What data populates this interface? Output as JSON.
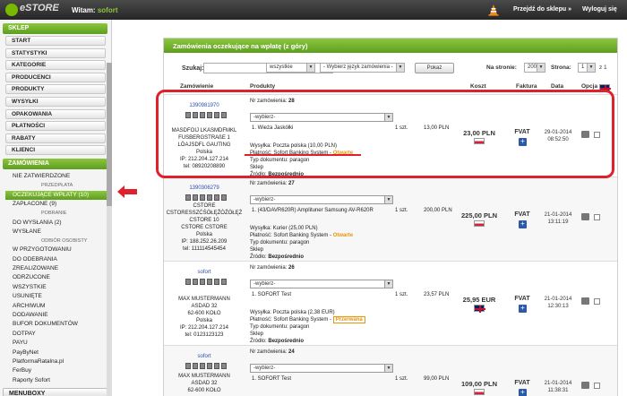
{
  "topbar": {
    "logo": "eSTORE",
    "welcome": "Witam:",
    "user": "sofort",
    "goto_store": "Przejdź do sklepu »",
    "logout": "Wyloguj się"
  },
  "sidebar": {
    "section1": "SKLEP",
    "items": [
      "START",
      "STATYSTYKI",
      "KATEGORIE",
      "PRODUCENCI",
      "PRODUKTY",
      "WYSYŁKI",
      "OPAKOWANIA",
      "PŁATNOŚCI",
      "RABATY",
      "KLIENCI"
    ],
    "section2": "ZAMÓWIENIA",
    "orders": [
      {
        "label": "NIE ZATWIERDZONE",
        "kind": "item"
      },
      {
        "label": "PRZEDPŁATA",
        "kind": "group"
      },
      {
        "label": "OCZEKUJĄCE WPŁATY (10)",
        "kind": "active"
      },
      {
        "label": "ZAPŁACONE (9)",
        "kind": "item"
      },
      {
        "label": "POBRANIE",
        "kind": "group"
      },
      {
        "label": "DO WYSŁANIA (2)",
        "kind": "item"
      },
      {
        "label": "WYSŁANE",
        "kind": "item"
      },
      {
        "label": "ODBIÓR OSOBISTY",
        "kind": "group"
      },
      {
        "label": "W PRZYGOTOWANIU",
        "kind": "item"
      },
      {
        "label": "DO ODEBRANIA",
        "kind": "item"
      }
    ],
    "orders2": [
      "ZREALIZOWANE",
      "ODRZUCONE",
      "WSZYSTKIE",
      "USUNIĘTE",
      "ARCHIWUM",
      "DODAWANIE",
      "BUFOR DOKUMENTÓW",
      "DOTPAY",
      "PAYU",
      "PayByNet",
      "PlatformaRatalna.pl",
      "FerBuy",
      "Raporty Sofort"
    ],
    "section3": "MENUBOXY"
  },
  "panel": {
    "title": "Zamówienia oczekujące na wpłatę (z góry)",
    "search_label": "Szukaj:",
    "filter_value": "wszystkie",
    "language_value": "- Wybierz język zamówienia -",
    "search_button": "Pokaż",
    "per_page_label": "Na stronie:",
    "per_page_value": "200",
    "page_label": "Strona:",
    "page_value": "1",
    "page_total": "z 1",
    "columns": {
      "order": "Zamówienie",
      "products": "Produkty",
      "cost": "Koszt",
      "invoice": "Faktura",
      "date": "Data",
      "option": "Opcja"
    }
  },
  "orders": [
    {
      "id_link": "1390981970",
      "customer": [
        "MASDFOIJ LKASMDFMKL",
        "FUSBERGSTRAßE 1",
        "LÖAJSDFL GAUTING",
        "Polska"
      ],
      "ip": "IP: 212.204.127.214",
      "tel": "tel: 08920208890",
      "order_no_label": "Nr zamówienia:",
      "order_no": "28",
      "select": "-wybierz-",
      "product": "1. Wieża Jaskółki",
      "qty": "1 szt.",
      "line_price": "13,00 PLN",
      "shipping": "Wysyłka: Poczta polska (10,00 PLN)",
      "payment": "Płatność: Sofort Banking System - ",
      "status": "Otwarte",
      "doc": "Typ dokumentu: paragon",
      "shop": "Sklep",
      "source_label": "Źródło:",
      "source": "Bezpośrednio",
      "price": "23,00 PLN",
      "invoice": "FVAT",
      "date": "29-01-2014",
      "time": "08:52:50"
    },
    {
      "id_link": "1390306279",
      "customer": [
        "CSTORE",
        "CSTORESSZĆŚÓŁĘŹÓŹÓŁĘŻ",
        "CSTORE 10",
        "CSTORE CSTORE",
        "Polska"
      ],
      "ip": "IP: 188.252.26.209",
      "tel": "tel: 111114545454",
      "order_no_label": "Nr zamówienia:",
      "order_no": "27",
      "select": "-wybierz-",
      "product": "1. (43/DAVR620R) Amplituner Samsung AV-R620R",
      "qty": "1 szt.",
      "line_price": "200,00 PLN",
      "shipping": "Wysyłka: Kurier (25,00 PLN)",
      "payment": "Płatność: Sofort Banking System - ",
      "status": "Otwarte",
      "doc": "Typ dokumentu: paragon",
      "shop": "Sklep",
      "source_label": "Źródło:",
      "source": "Bezpośrednio",
      "price": "225,00 PLN",
      "invoice": "FVAT",
      "date": "21-01-2014",
      "time": "13:11:19"
    },
    {
      "id_link": "sofort",
      "customer": [
        "MAX MUSTERMANN",
        "ASDAD 32",
        "62-600 KOŁO",
        "Polska"
      ],
      "ip": "IP: 212.204.127.214",
      "tel": "tel: 0123123123",
      "order_no_label": "Nr zamówienia:",
      "order_no": "26",
      "select": "-wybierz-",
      "product": "1. SOFORT Test",
      "qty": "1 szt.",
      "line_price": "23,57 PLN",
      "shipping": "Wysyłka: Poczta polska (2,38 EUR)",
      "payment": "Płatność: Sofort Banking System - ",
      "status": "Przerwana",
      "doc": "Typ dokumentu: paragon",
      "shop": "Sklep",
      "source_label": "Źródło:",
      "source": "Bezpośrednio",
      "price": "25,95 EUR",
      "invoice": "FVAT",
      "date": "21-01-2014",
      "time": "12:30:13"
    },
    {
      "id_link": "sofort",
      "customer": [
        "MAX MUSTERMANN",
        "ASDAD 32",
        "62-600 KOŁO"
      ],
      "ip": "",
      "tel": "",
      "order_no_label": "Nr zamówienia:",
      "order_no": "24",
      "select": "-wybierz-",
      "product": "1. SOFORT Test",
      "qty": "1 szt.",
      "line_price": "99,00 PLN",
      "shipping": "",
      "payment": "",
      "status": "",
      "doc": "",
      "shop": "",
      "source_label": "",
      "source": "",
      "price": "109,00 PLN",
      "invoice": "FVAT",
      "date": "21-01-2014",
      "time": "11:38:31"
    }
  ]
}
